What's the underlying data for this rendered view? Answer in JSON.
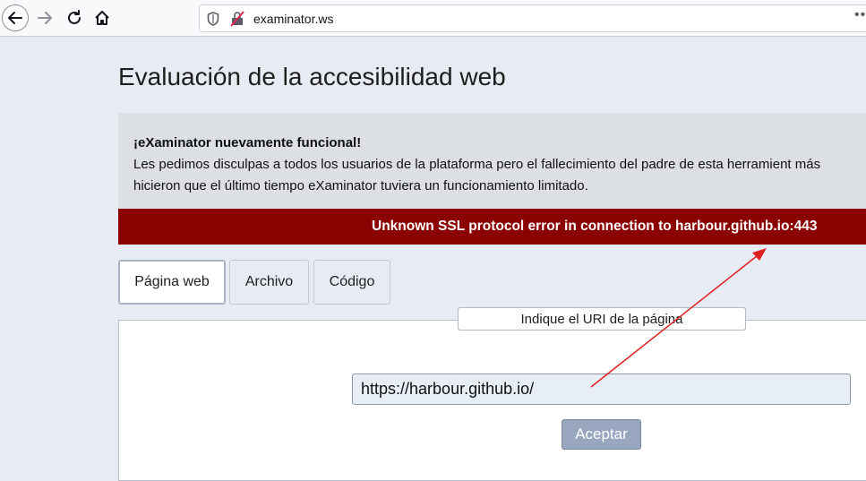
{
  "browser": {
    "url": "examinator.ws",
    "back_icon": "arrow-left-icon",
    "forward_icon": "arrow-right-icon",
    "reload_icon": "reload-icon",
    "home_icon": "home-icon",
    "more_label": "••"
  },
  "page": {
    "title": "Evaluación de la accesibilidad web"
  },
  "notice": {
    "title": "¡eXaminator nuevamente funcional!",
    "line1": "Les pedimos disculpas a todos los usuarios de la plataforma pero el fallecimiento del padre de esta herramient más",
    "line2": "hicieron que el último tiempo eXaminator tuviera un funcionamiento limitado."
  },
  "error": {
    "message": "Unknown SSL protocol error in connection to harbour.github.io:443",
    "color": "#8b0000"
  },
  "tabs": [
    {
      "label": "Página web",
      "active": true
    },
    {
      "label": "Archivo",
      "active": false
    },
    {
      "label": "Código",
      "active": false
    }
  ],
  "form": {
    "legend": "Indique el URI de la página",
    "uri_value": "https://harbour.github.io/",
    "submit_label": "Aceptar"
  },
  "annotation": {
    "color": "#e02020"
  }
}
